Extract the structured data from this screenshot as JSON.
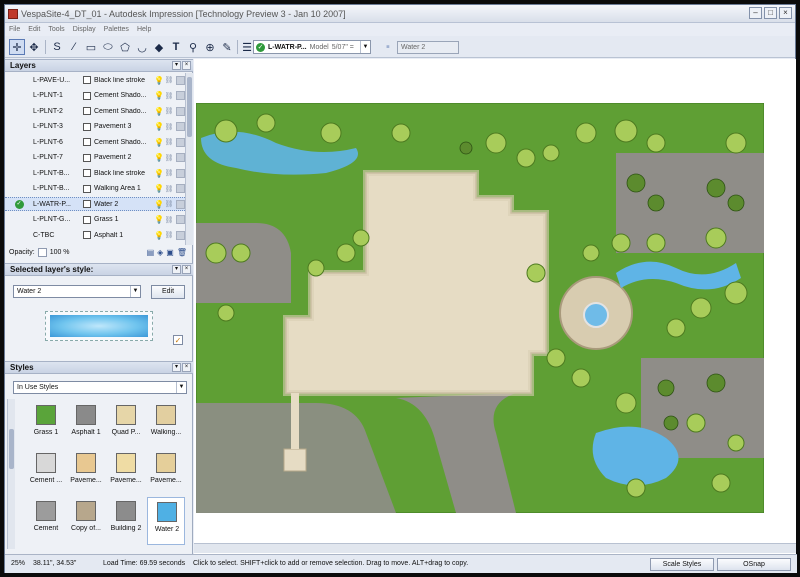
{
  "window": {
    "title": "VespaSite-4_DT_01 - Autodesk Impression [Technology Preview 3 - Jan 10 2007]"
  },
  "menu": [
    "File",
    "Edit",
    "Tools",
    "Display",
    "Palettes",
    "Help"
  ],
  "toolbar": {
    "tools": [
      "select-tool",
      "pan-tool",
      "freehand-tool",
      "line-tool",
      "rectangle-tool",
      "ellipse-tool",
      "polygon-tool",
      "fill-tool",
      "text-tool",
      "magnifier-tool",
      "zoom-tool",
      "eyedropper-tool"
    ],
    "active_layer": "L-WATR-P...",
    "active_model": "Model",
    "active_scale": "5/07\" =",
    "style_field": "Water 2"
  },
  "layers_panel": {
    "title": "Layers",
    "rows": [
      {
        "name": "L-PAVE-U...",
        "style": "Black line stroke"
      },
      {
        "name": "L-PLNT-1",
        "style": "Cement Shado..."
      },
      {
        "name": "L-PLNT-2",
        "style": "Cement Shado..."
      },
      {
        "name": "L-PLNT-3",
        "style": "Pavement 3"
      },
      {
        "name": "L-PLNT-6",
        "style": "Cement Shado..."
      },
      {
        "name": "L-PLNT-7",
        "style": "Pavement 2"
      },
      {
        "name": "L-PLNT-B...",
        "style": "Black line stroke"
      },
      {
        "name": "L-PLNT-B...",
        "style": "Walking Area 1"
      },
      {
        "name": "L-WATR-P...",
        "style": "Water 2"
      },
      {
        "name": "L-PLNT-G...",
        "style": "Grass 1"
      },
      {
        "name": "C-TBC",
        "style": "Asphalt 1"
      }
    ],
    "selected_index": 8,
    "opacity_label": "Opacity:",
    "opacity_value": "100 %"
  },
  "selected_style_panel": {
    "title": "Selected layer's style:",
    "style_name": "Water 2",
    "edit_label": "Edit"
  },
  "styles_panel": {
    "title": "Styles",
    "filter": "In Use Styles",
    "tiles": [
      {
        "label": "Grass 1",
        "color": "#5aa43a"
      },
      {
        "label": "Asphalt 1",
        "color": "#8a8a8a"
      },
      {
        "label": "Quad P...",
        "color": "#e6d6a8"
      },
      {
        "label": "Walking...",
        "color": "#e2cfa0"
      },
      {
        "label": "Cement ...",
        "color": "#d8d8d8"
      },
      {
        "label": "Paveme...",
        "color": "#e8c891"
      },
      {
        "label": "Paveme...",
        "color": "#efdca4"
      },
      {
        "label": "Paveme...",
        "color": "#e5cf9a"
      },
      {
        "label": "Cement",
        "color": "#9c9c9c"
      },
      {
        "label": "Copy of...",
        "color": "#b7a78c"
      },
      {
        "label": "Building 2",
        "color": "#8c8c8c"
      },
      {
        "label": "Water 2",
        "color": "#4fb0e4"
      }
    ],
    "selected_tile": 11
  },
  "status": {
    "zoom": "25%",
    "coords": "38.11\", 34.53\"",
    "load_time": "Load Time: 69.59 seconds",
    "hint": "Click to select. SHIFT+click to add or remove selection. Drag to move. ALT+drag to copy.",
    "scale_styles": "Scale Styles",
    "osnap": "OSnap"
  },
  "colors": {
    "grass": "#5f9f34",
    "plaza": "#e6dcc4",
    "asphalt": "#8f8d88",
    "water": "#5fb4e6",
    "accent": "#2f9a3b"
  }
}
